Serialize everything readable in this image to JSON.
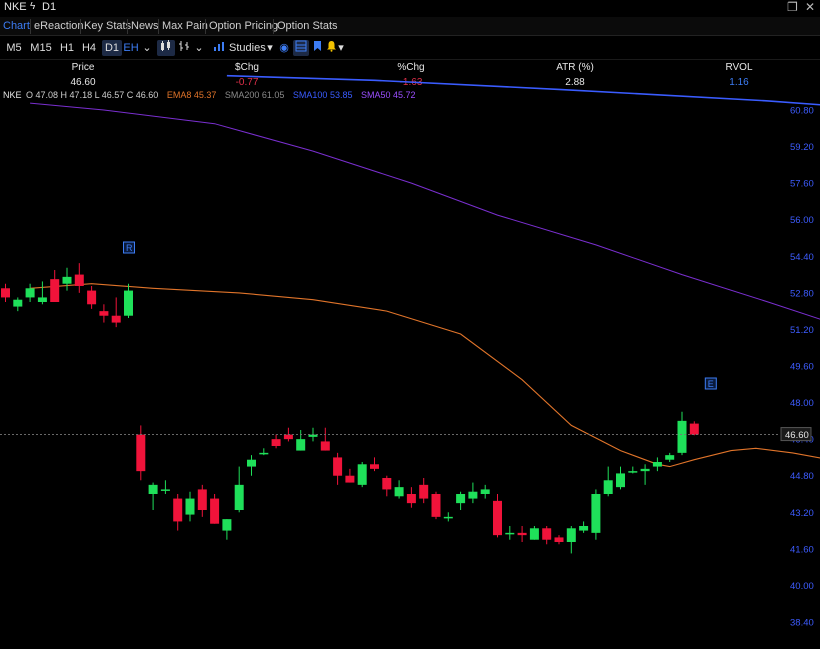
{
  "header": {
    "symbol": "NKE",
    "timeframe": "D1",
    "bolt_icon": "lightning-icon"
  },
  "window_controls": {
    "restore": "❐",
    "close": "✕"
  },
  "tabs": [
    {
      "label": "Chart",
      "active": true
    },
    {
      "label": "eReaction"
    },
    {
      "label": "Key Stats"
    },
    {
      "label": "News"
    },
    {
      "label": "Max Pain"
    },
    {
      "label": "Option Pricing"
    },
    {
      "label": "Option Stats"
    }
  ],
  "toolbar": {
    "intervals": [
      "M5",
      "M15",
      "H1",
      "H4",
      "D1"
    ],
    "selected_interval": "D1",
    "eh": "EH",
    "studies": "Studies"
  },
  "quote": {
    "headers": [
      "Price",
      "$Chg",
      "%Chg",
      "ATR (%)",
      "RVOL"
    ],
    "values": [
      "46.60",
      "-0.77",
      "-1.63",
      "2.88",
      "1.16"
    ]
  },
  "legend": {
    "symbol": "NKE",
    "ohlc": "O 47.08  H 47.18  L 46.57  C 46.60",
    "ema8": "EMA8  45.37",
    "sma200": "SMA200  61.05",
    "sma100": "SMA100  53.85",
    "sma50": "SMA50  45.72"
  },
  "colors": {
    "up": "#1fe05a",
    "down": "#f0133a",
    "ema8": "#e0742a",
    "sma200": "#8a8a8a",
    "sma100": "#3a5cff",
    "sma50": "#7a2fd0",
    "accent": "#3d7df5",
    "neg": "#e0304a"
  },
  "chart_data": {
    "type": "candlestick",
    "y_axis": {
      "ticks": [
        "60.80",
        "59.20",
        "57.60",
        "56.00",
        "54.40",
        "52.80",
        "51.20",
        "49.60",
        "48.00",
        "46.40",
        "44.80",
        "43.20",
        "41.60",
        "40.00",
        "38.40"
      ],
      "last_price_label": "46.60"
    },
    "ylim": [
      37.5,
      62.3
    ],
    "candles": [
      [
        53.0,
        53.2,
        52.4,
        52.6
      ],
      [
        52.2,
        52.6,
        52.0,
        52.5
      ],
      [
        52.6,
        53.2,
        52.4,
        53.0
      ],
      [
        52.4,
        53.3,
        52.3,
        52.6
      ],
      [
        53.4,
        53.8,
        52.6,
        52.4
      ],
      [
        53.2,
        53.9,
        52.9,
        53.5
      ],
      [
        53.6,
        54.1,
        52.8,
        53.1
      ],
      [
        52.9,
        53.1,
        52.1,
        52.3
      ],
      [
        52.0,
        52.3,
        51.5,
        51.8
      ],
      [
        51.8,
        52.6,
        51.3,
        51.5
      ],
      [
        51.8,
        53.2,
        51.7,
        52.9
      ],
      [
        46.6,
        47.0,
        44.6,
        45.0
      ],
      [
        44.0,
        44.5,
        43.3,
        44.4
      ],
      [
        44.2,
        44.6,
        44.0,
        44.2
      ],
      [
        43.8,
        44.0,
        42.4,
        42.8
      ],
      [
        43.1,
        44.1,
        42.8,
        43.8
      ],
      [
        44.2,
        44.4,
        43.0,
        43.3
      ],
      [
        43.8,
        44.0,
        42.7,
        42.7
      ],
      [
        42.4,
        42.9,
        42.0,
        42.9
      ],
      [
        43.3,
        45.2,
        43.2,
        44.4
      ],
      [
        45.2,
        45.7,
        44.8,
        45.5
      ],
      [
        45.8,
        46.0,
        45.7,
        45.8
      ],
      [
        46.4,
        46.6,
        46.0,
        46.1
      ],
      [
        46.6,
        46.9,
        46.3,
        46.4
      ],
      [
        45.9,
        46.8,
        45.9,
        46.4
      ],
      [
        46.5,
        46.9,
        46.3,
        46.6
      ],
      [
        46.3,
        46.9,
        45.9,
        45.9
      ],
      [
        45.6,
        45.8,
        44.4,
        44.8
      ],
      [
        44.8,
        45.1,
        44.5,
        44.5
      ],
      [
        44.4,
        45.4,
        44.3,
        45.3
      ],
      [
        45.3,
        45.6,
        45.0,
        45.1
      ],
      [
        44.7,
        44.8,
        43.9,
        44.2
      ],
      [
        43.9,
        44.6,
        43.8,
        44.3
      ],
      [
        44.0,
        44.3,
        43.4,
        43.6
      ],
      [
        44.4,
        44.7,
        43.6,
        43.8
      ],
      [
        44.0,
        44.1,
        42.9,
        43.0
      ],
      [
        43.0,
        43.2,
        42.8,
        43.0
      ],
      [
        43.6,
        44.1,
        43.3,
        44.0
      ],
      [
        43.8,
        44.5,
        43.6,
        44.1
      ],
      [
        44.0,
        44.4,
        43.8,
        44.2
      ],
      [
        43.7,
        44.0,
        42.1,
        42.2
      ],
      [
        42.3,
        42.6,
        42.0,
        42.3
      ],
      [
        42.3,
        42.6,
        41.9,
        42.2
      ],
      [
        42.0,
        42.6,
        42.0,
        42.5
      ],
      [
        42.5,
        42.6,
        41.8,
        42.0
      ],
      [
        42.1,
        42.2,
        41.8,
        41.9
      ],
      [
        41.9,
        42.6,
        41.4,
        42.5
      ],
      [
        42.4,
        42.8,
        42.3,
        42.6
      ],
      [
        42.3,
        44.2,
        42.0,
        44.0
      ],
      [
        44.0,
        45.2,
        43.9,
        44.6
      ],
      [
        44.3,
        45.2,
        44.2,
        44.9
      ],
      [
        45.0,
        45.2,
        44.9,
        45.0
      ],
      [
        45.0,
        45.3,
        44.4,
        45.1
      ],
      [
        45.2,
        45.6,
        45.0,
        45.4
      ],
      [
        45.5,
        45.8,
        45.4,
        45.7
      ],
      [
        45.8,
        47.6,
        45.7,
        47.2
      ],
      [
        47.08,
        47.18,
        46.57,
        46.6
      ]
    ],
    "ema8": [
      [
        53.0,
        2
      ],
      [
        53.2,
        7
      ],
      [
        53.0,
        12
      ],
      [
        52.8,
        19
      ],
      [
        52.5,
        25
      ],
      [
        52.0,
        31
      ],
      [
        51.0,
        37
      ],
      [
        49.0,
        42
      ],
      [
        47.0,
        46
      ],
      [
        45.9,
        50
      ],
      [
        45.3,
        53
      ],
      [
        45.2,
        54
      ],
      [
        45.5,
        56
      ],
      [
        45.9,
        59
      ],
      [
        46.0,
        61
      ],
      [
        45.8,
        64
      ],
      [
        45.5,
        67
      ],
      [
        45.3,
        70
      ],
      [
        45.3,
        73
      ],
      [
        45.1,
        77
      ],
      [
        44.8,
        80
      ],
      [
        44.6,
        83
      ],
      [
        44.3,
        86
      ],
      [
        43.9,
        89
      ],
      [
        43.6,
        91
      ],
      [
        43.1,
        94
      ],
      [
        42.9,
        97
      ],
      [
        42.7,
        100
      ],
      [
        42.6,
        103
      ],
      [
        42.6,
        106
      ],
      [
        42.8,
        109
      ],
      [
        43.3,
        112
      ],
      [
        43.8,
        115
      ],
      [
        44.4,
        118
      ],
      [
        44.9,
        121
      ],
      [
        45.37,
        123
      ]
    ],
    "sma200": [
      [
        61.9,
        92
      ],
      [
        61.75,
        100
      ],
      [
        61.55,
        110
      ],
      [
        61.35,
        118
      ],
      [
        61.05,
        123
      ]
    ],
    "sma100": [
      [
        62.3,
        18
      ],
      [
        62.1,
        30
      ],
      [
        61.7,
        45
      ],
      [
        61.2,
        62
      ],
      [
        60.6,
        77
      ],
      [
        59.5,
        90
      ],
      [
        58.2,
        98
      ],
      [
        56.6,
        106
      ],
      [
        55.6,
        112
      ],
      [
        54.8,
        118
      ],
      [
        54.3,
        121
      ],
      [
        53.85,
        123
      ]
    ],
    "sma50": [
      [
        61.1,
        2
      ],
      [
        60.8,
        8
      ],
      [
        60.2,
        17
      ],
      [
        59.0,
        25
      ],
      [
        57.6,
        33
      ],
      [
        56.2,
        40
      ],
      [
        54.9,
        48
      ],
      [
        53.6,
        55
      ],
      [
        52.4,
        62
      ],
      [
        50.8,
        71
      ],
      [
        49.4,
        79
      ],
      [
        48.2,
        88
      ],
      [
        47.3,
        98
      ],
      [
        46.7,
        106
      ],
      [
        46.2,
        114
      ],
      [
        45.72,
        123
      ]
    ]
  },
  "markers": [
    {
      "label": "R",
      "kind": "earnings-marker"
    },
    {
      "label": "E",
      "kind": "earnings-marker"
    }
  ]
}
